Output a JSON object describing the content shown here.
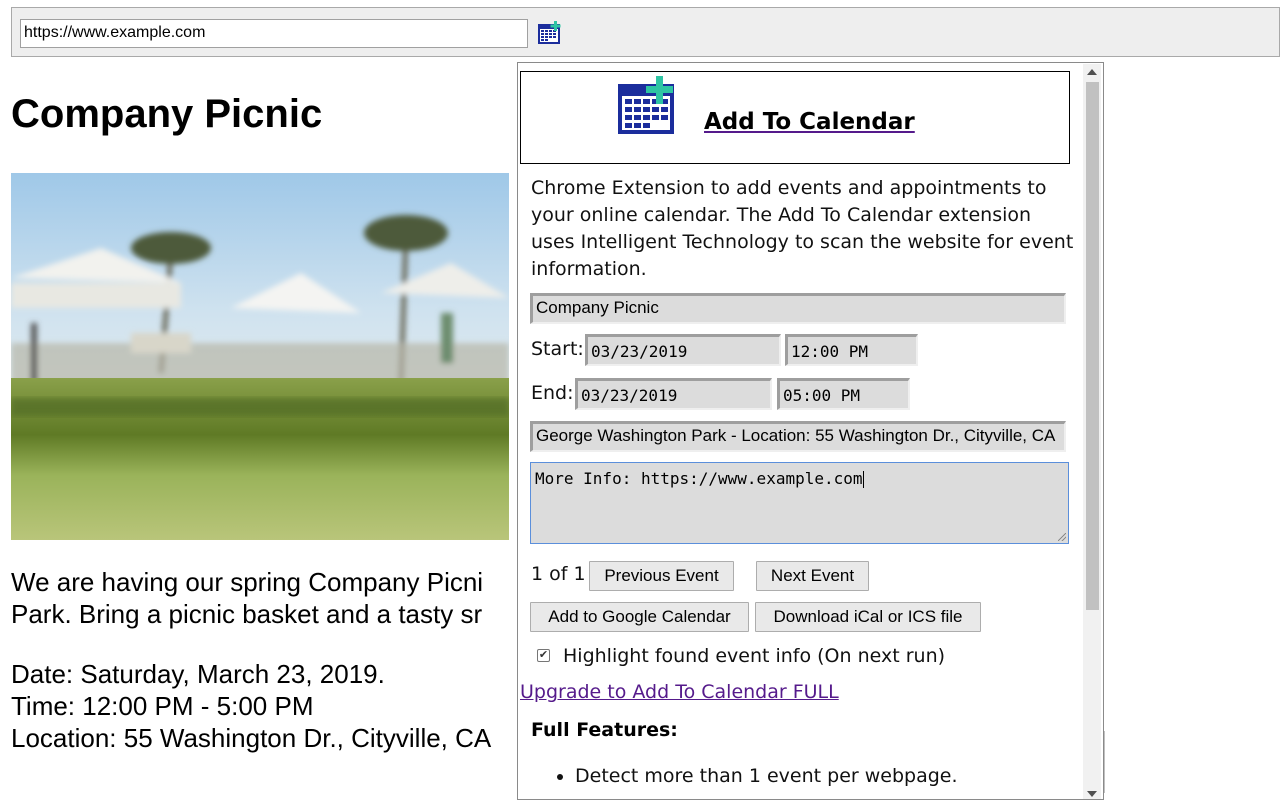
{
  "browser": {
    "url": "https://www.example.com",
    "extension_icon": "calendar-plus-icon"
  },
  "page": {
    "title": "Company Picnic",
    "photo_icon": "picnic-park-photo",
    "paragraph_line1": "We are having our spring Company Picni",
    "paragraph_line2": "Park. Bring a picnic basket and a tasty sr",
    "date": "Date: Saturday, March 23, 2019.",
    "time": "Time: 12:00 PM - 5:00 PM",
    "location": "Location: 55 Washington Dr., Cityville, CA"
  },
  "popup": {
    "header_link": "Add To Calendar ",
    "description": "Chrome Extension to add events and appointments to your online calendar. The Add To Calendar extension uses Intelligent Technology to scan the website for event information.",
    "event_title": "Company Picnic",
    "start_label": "Start:",
    "start_date": "03/23/2019",
    "start_time": "12:00 PM",
    "end_label": "End:",
    "end_date": "03/23/2019",
    "end_time": "05:00 PM",
    "location": "George Washington Park - Location: 55 Washington Dr., Cityville, CA",
    "details": "More Info: https://www.example.com",
    "pager": "1 of 1",
    "prev_button": "Previous Event",
    "next_button": "Next Event",
    "google_button": "Add to Google Calendar",
    "ical_button": "Download iCal or ICS file",
    "highlight_checked": true,
    "highlight_label": "Highlight found event info (On next run)",
    "upgrade_link": "Upgrade to Add To Calendar FULL",
    "features_heading": "Full Features:",
    "features": [
      "Detect more than 1 event per webpage."
    ]
  },
  "colors": {
    "calendar_blue": "#1b2d9c",
    "calendar_plus": "#2ec4a3",
    "link_visited": "#551a8b"
  }
}
